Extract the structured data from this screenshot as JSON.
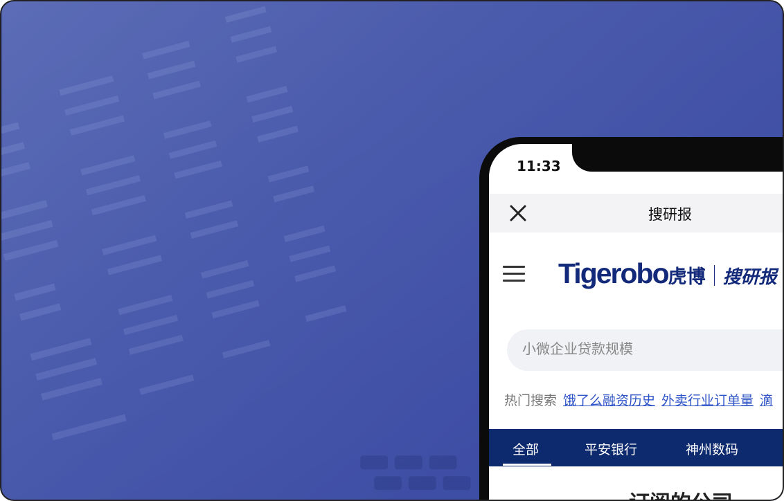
{
  "status": {
    "time": "11:33"
  },
  "navbar": {
    "title": "搜研报"
  },
  "logo": {
    "en": "Tigerobo",
    "cn": "虎博",
    "sub": "搜研报"
  },
  "search": {
    "placeholder": "小微企业贷款规模"
  },
  "hot": {
    "label": "热门搜索",
    "links": [
      "饿了么融资历史",
      "外卖行业订单量",
      "滴"
    ]
  },
  "tabs": [
    "全部",
    "平安银行",
    "神州数码"
  ],
  "content": {
    "title": "· 订阅的公司 ·"
  },
  "colors": {
    "background": "#3e4fa6",
    "brand": "#13297a",
    "tabs_bar": "#0d2a6e",
    "link": "#2f54c8"
  }
}
